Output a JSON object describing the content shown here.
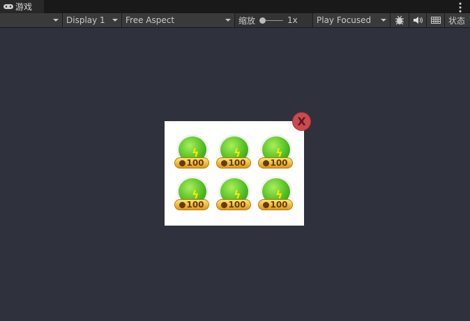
{
  "tab": {
    "label": "游戏",
    "icon": "gamepad-icon"
  },
  "toolbar": {
    "display": "Display 1",
    "aspect": "Free Aspect",
    "scale_label": "缩放",
    "scale_value": "1x",
    "play_mode": "Play Focused",
    "stats": "状态"
  },
  "popup": {
    "items": [
      {
        "price": "100"
      },
      {
        "price": "100"
      },
      {
        "price": "100"
      },
      {
        "price": "100"
      },
      {
        "price": "100"
      },
      {
        "price": "100"
      }
    ],
    "close_label": "X"
  }
}
